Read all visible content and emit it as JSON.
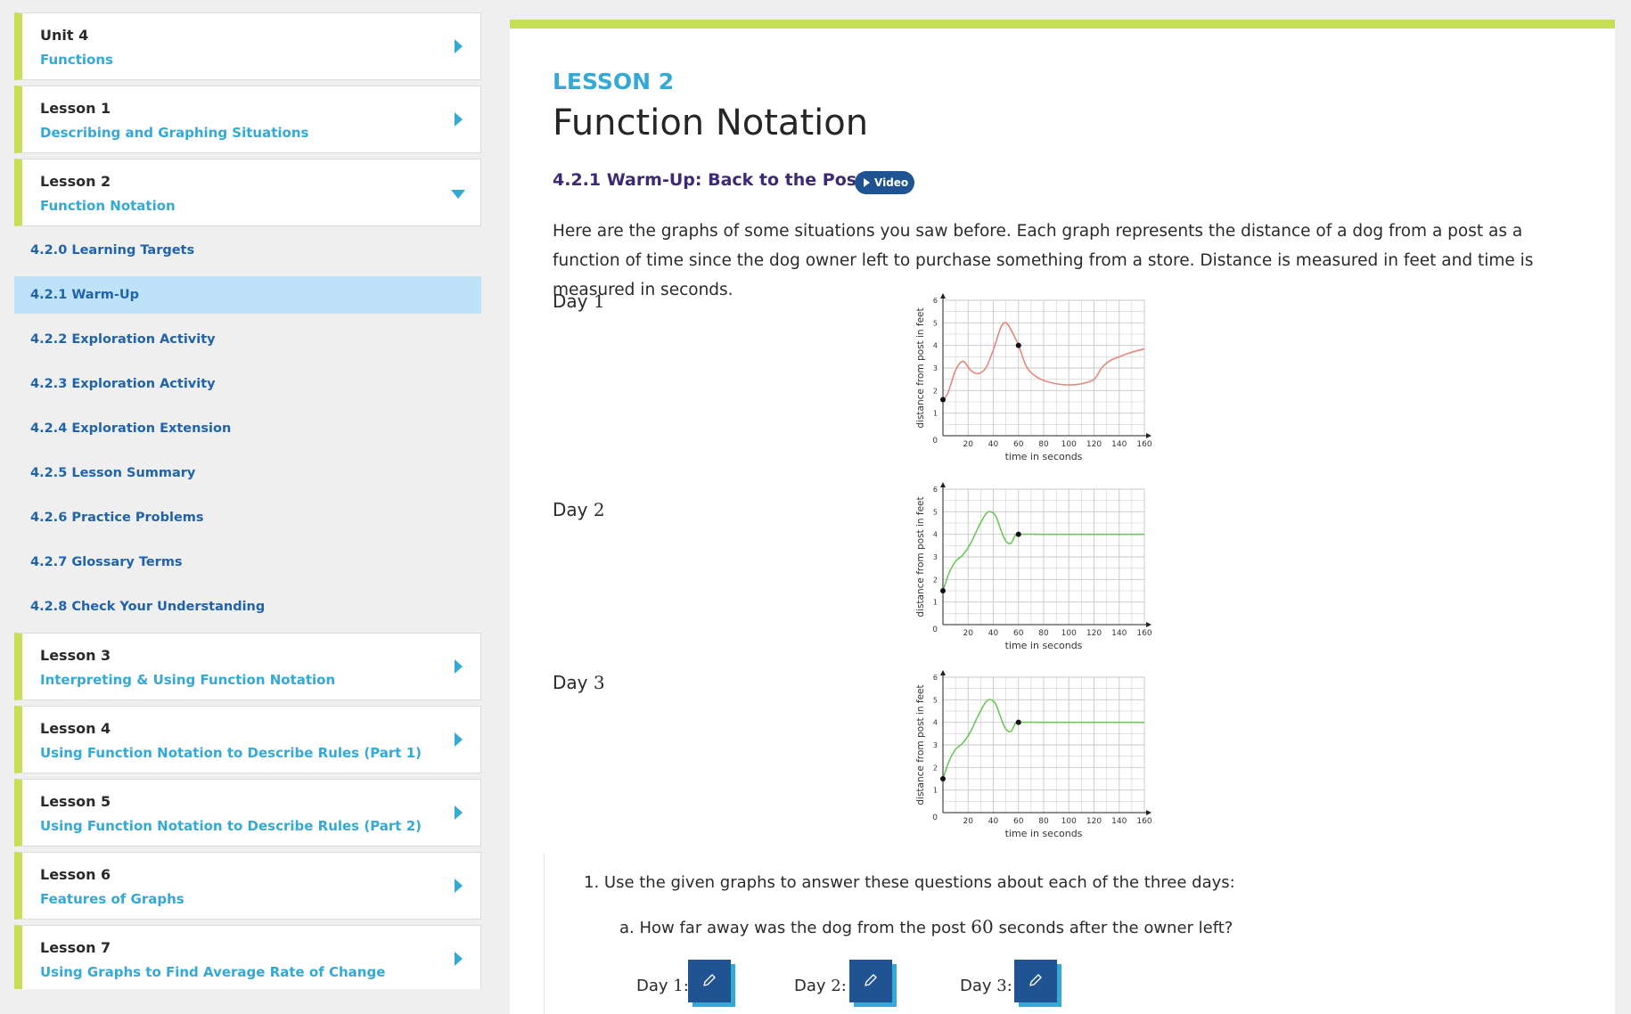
{
  "sidebar": {
    "unit": {
      "title": "Unit 4",
      "subtitle": "Functions"
    },
    "lessons_before": [
      {
        "title": "Lesson 1",
        "subtitle": "Describing and Graphing Situations"
      },
      {
        "title": "Lesson 2",
        "subtitle": "Function Notation"
      }
    ],
    "sub_items": [
      {
        "label": "4.2.0 Learning Targets"
      },
      {
        "label": "4.2.1 Warm-Up"
      },
      {
        "label": "4.2.2 Exploration Activity"
      },
      {
        "label": "4.2.3 Exploration Activity"
      },
      {
        "label": "4.2.4 Exploration Extension"
      },
      {
        "label": "4.2.5 Lesson Summary"
      },
      {
        "label": "4.2.6 Practice Problems"
      },
      {
        "label": "4.2.7 Glossary Terms"
      },
      {
        "label": "4.2.8 Check Your Understanding"
      }
    ],
    "lessons_after": [
      {
        "title": "Lesson 3",
        "subtitle": "Interpreting & Using Function Notation"
      },
      {
        "title": "Lesson 4",
        "subtitle": "Using Function Notation to Describe Rules (Part 1)"
      },
      {
        "title": "Lesson 5",
        "subtitle": "Using Function Notation to Describe Rules (Part 2)"
      },
      {
        "title": "Lesson 6",
        "subtitle": "Features of Graphs"
      },
      {
        "title": "Lesson 7",
        "subtitle": "Using Graphs to Find Average Rate of Change"
      }
    ]
  },
  "main": {
    "lesson_label": "LESSON 2",
    "lesson_title": "Function Notation",
    "warmup_title": "4.2.1 Warm-Up: Back to the Post!",
    "video_label": "Video",
    "intro": "Here are the graphs of some situations you saw before. Each graph represents the distance of a dog from a post as a function of time since the dog owner left to purchase something from a store. Distance is measured in feet and time is measured in seconds.",
    "days": [
      {
        "word": "Day",
        "num": "1"
      },
      {
        "word": "Day",
        "num": "2"
      },
      {
        "word": "Day",
        "num": "3"
      }
    ],
    "question1": "1. Use the given graphs to answer these questions about each of the three days:",
    "question_a_pre": "a. How far away was the dog from the post ",
    "question_a_num": "60",
    "question_a_post": " seconds after the owner left?",
    "answers": [
      {
        "word": "Day",
        "num": "1",
        "colon": ":"
      },
      {
        "word": "Day",
        "num": "2",
        "colon": ":"
      },
      {
        "word": "Day",
        "num": "3",
        "colon": ":"
      }
    ]
  },
  "colors": {
    "accent_green": "#c6df55",
    "link_blue": "#35a9d6",
    "nav_blue": "#1f63ad",
    "day1_curve": "#e8867a",
    "day23_curve": "#6cc85a"
  },
  "chart_data": [
    {
      "type": "line",
      "title": "",
      "xlabel": "time in seconds",
      "ylabel": "distance from post in feet",
      "x_ticks": [
        "20",
        "40",
        "60",
        "80",
        "100",
        "120",
        "140",
        "160"
      ],
      "y_ticks": [
        "1",
        "2",
        "3",
        "4",
        "5",
        "6"
      ],
      "origin_label": "0",
      "xlim": [
        0,
        160
      ],
      "ylim": [
        0,
        6
      ],
      "color": "#e8867a",
      "x": [
        0,
        4,
        10,
        16,
        22,
        28,
        34,
        40,
        46,
        50,
        54,
        60,
        66,
        72,
        80,
        90,
        100,
        110,
        120,
        126,
        132,
        140,
        150,
        160
      ],
      "y": [
        1.6,
        1.9,
        2.9,
        3.3,
        2.9,
        2.75,
        3.0,
        3.8,
        4.8,
        5.0,
        4.7,
        4.0,
        3.1,
        2.7,
        2.45,
        2.3,
        2.25,
        2.3,
        2.5,
        3.0,
        3.3,
        3.5,
        3.7,
        3.85
      ],
      "points": [
        {
          "x": 0,
          "y": 1.6
        },
        {
          "x": 60,
          "y": 4.0
        }
      ]
    },
    {
      "type": "line",
      "title": "",
      "xlabel": "time in seconds",
      "ylabel": "distance from post in feet",
      "x_ticks": [
        "20",
        "40",
        "60",
        "80",
        "100",
        "120",
        "140",
        "160"
      ],
      "y_ticks": [
        "1",
        "2",
        "3",
        "4",
        "5",
        "6"
      ],
      "origin_label": "0",
      "xlim": [
        0,
        160
      ],
      "ylim": [
        0,
        6
      ],
      "color": "#6cc85a",
      "x": [
        0,
        5,
        10,
        16,
        22,
        28,
        34,
        38,
        42,
        46,
        50,
        54,
        57,
        60,
        80,
        100,
        120,
        140,
        160
      ],
      "y": [
        1.5,
        2.3,
        2.8,
        3.1,
        3.6,
        4.3,
        4.9,
        5.0,
        4.8,
        4.2,
        3.7,
        3.6,
        3.9,
        4.0,
        4.0,
        4.0,
        4.0,
        4.0,
        4.0
      ],
      "points": [
        {
          "x": 0,
          "y": 1.5
        },
        {
          "x": 60,
          "y": 4.0
        }
      ]
    },
    {
      "type": "line",
      "title": "",
      "xlabel": "time in seconds",
      "ylabel": "distance from post in feet",
      "x_ticks": [
        "20",
        "40",
        "60",
        "80",
        "100",
        "120",
        "140",
        "160"
      ],
      "y_ticks": [
        "1",
        "2",
        "3",
        "4",
        "5",
        "6"
      ],
      "origin_label": "0",
      "xlim": [
        0,
        160
      ],
      "ylim": [
        0,
        6
      ],
      "color": "#6cc85a",
      "x": [
        0,
        5,
        10,
        16,
        22,
        28,
        34,
        38,
        42,
        46,
        50,
        54,
        57,
        60,
        80,
        100,
        120,
        140,
        160
      ],
      "y": [
        1.5,
        2.3,
        2.8,
        3.1,
        3.6,
        4.3,
        4.9,
        5.0,
        4.8,
        4.2,
        3.7,
        3.6,
        3.9,
        4.0,
        4.0,
        4.0,
        4.0,
        4.0,
        4.0
      ],
      "points": [
        {
          "x": 0,
          "y": 1.5
        },
        {
          "x": 60,
          "y": 4.0
        }
      ]
    }
  ]
}
